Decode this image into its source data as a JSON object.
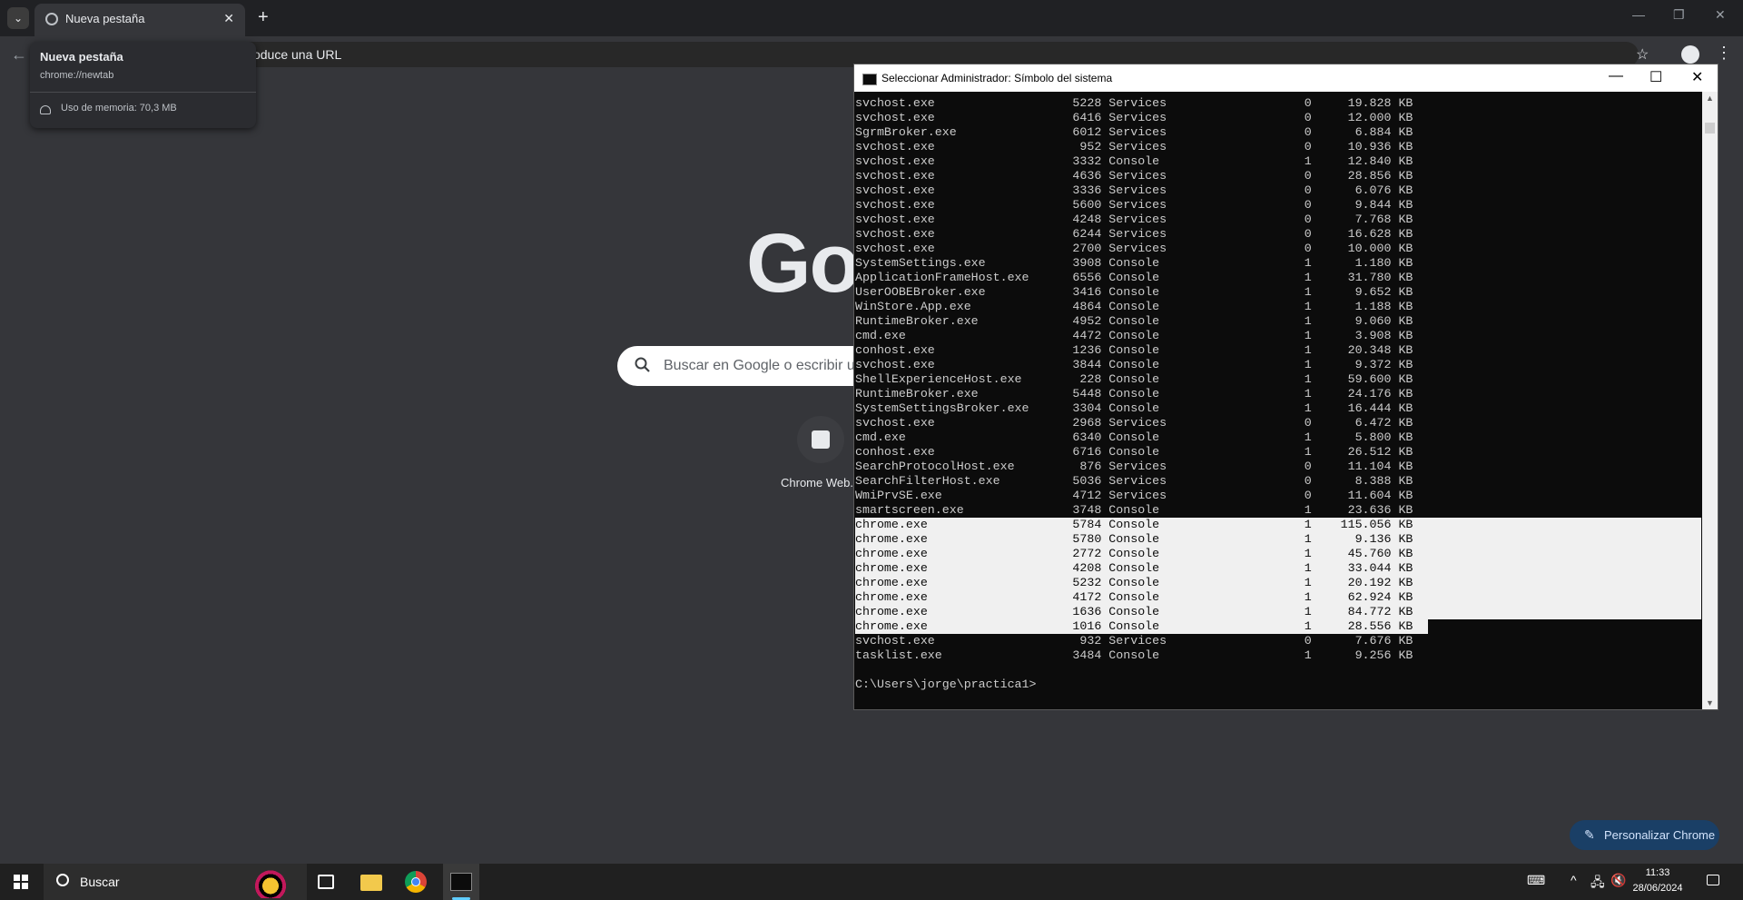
{
  "chrome": {
    "tab_title": "Nueva pestaña",
    "tab_close": "✕",
    "new_tab": "+",
    "tab_list": "⌄",
    "omnibox_placeholder": "Busca Google o introduce una URL",
    "hovercard": {
      "title": "Nueva pestaña",
      "url": "chrome://newtab",
      "memory": "Uso de memoria: 70,3 MB"
    },
    "window_controls": {
      "minimize": "—",
      "restore": "❐",
      "close": "✕"
    },
    "back": "←",
    "star": "☆",
    "menu": "⋮"
  },
  "newtab": {
    "logo": "Go",
    "search_placeholder": "Buscar en Google o escribir ur",
    "shortcut_label": "Chrome Web...",
    "customize_label": "Personalizar Chrome",
    "customize_icon": "✎"
  },
  "cmd": {
    "title": "Seleccionar Administrador: Símbolo del sistema",
    "controls": {
      "minimize": "—",
      "maximize": "☐",
      "close": "✕"
    },
    "lines": [
      "svchost.exe                   5228 Services                   0     19.828 KB",
      "svchost.exe                   6416 Services                   0     12.000 KB",
      "SgrmBroker.exe                6012 Services                   0      6.884 KB",
      "svchost.exe                    952 Services                   0     10.936 KB",
      "svchost.exe                   3332 Console                    1     12.840 KB",
      "svchost.exe                   4636 Services                   0     28.856 KB",
      "svchost.exe                   3336 Services                   0      6.076 KB",
      "svchost.exe                   5600 Services                   0      9.844 KB",
      "svchost.exe                   4248 Services                   0      7.768 KB",
      "svchost.exe                   6244 Services                   0     16.628 KB",
      "svchost.exe                   2700 Services                   0     10.000 KB",
      "SystemSettings.exe            3908 Console                    1      1.180 KB",
      "ApplicationFrameHost.exe      6556 Console                    1     31.780 KB",
      "UserOOBEBroker.exe            3416 Console                    1      9.652 KB",
      "WinStore.App.exe              4864 Console                    1      1.188 KB",
      "RuntimeBroker.exe             4952 Console                    1      9.060 KB",
      "cmd.exe                       4472 Console                    1      3.908 KB",
      "conhost.exe                   1236 Console                    1     20.348 KB",
      "svchost.exe                   3844 Console                    1      9.372 KB",
      "ShellExperienceHost.exe        228 Console                    1     59.600 KB",
      "RuntimeBroker.exe             5448 Console                    1     24.176 KB",
      "SystemSettingsBroker.exe      3304 Console                    1     16.444 KB",
      "svchost.exe                   2968 Services                   0      6.472 KB",
      "cmd.exe                       6340 Console                    1      5.800 KB",
      "conhost.exe                   6716 Console                    1     26.512 KB",
      "SearchProtocolHost.exe         876 Services                   0     11.104 KB",
      "SearchFilterHost.exe          5036 Services                   0      8.388 KB",
      "WmiPrvSE.exe                  4712 Services                   0     11.604 KB",
      "smartscreen.exe               3748 Console                    1     23.636 KB",
      "chrome.exe                    5784 Console                    1    115.056 KB",
      "chrome.exe                    5780 Console                    1      9.136 KB",
      "chrome.exe                    2772 Console                    1     45.760 KB",
      "chrome.exe                    4208 Console                    1     33.044 KB",
      "chrome.exe                    5232 Console                    1     20.192 KB",
      "chrome.exe                    4172 Console                    1     62.924 KB",
      "chrome.exe                    1636 Console                    1     84.772 KB",
      "chrome.exe                    1016 Console                    1     28.556 KB",
      "svchost.exe                    932 Services                   0      7.676 KB",
      "tasklist.exe                  3484 Console                    1      9.256 KB",
      "",
      "C:\\Users\\jorge\\practica1>"
    ],
    "selected_rows": [
      29,
      30,
      31,
      32,
      33,
      34,
      35,
      36
    ]
  },
  "taskbar": {
    "search_label": "Buscar",
    "time": "11:33",
    "date": "28/06/2024",
    "tray_chevron": "^",
    "tray_network": "🖧",
    "tray_volume": "🔇"
  }
}
